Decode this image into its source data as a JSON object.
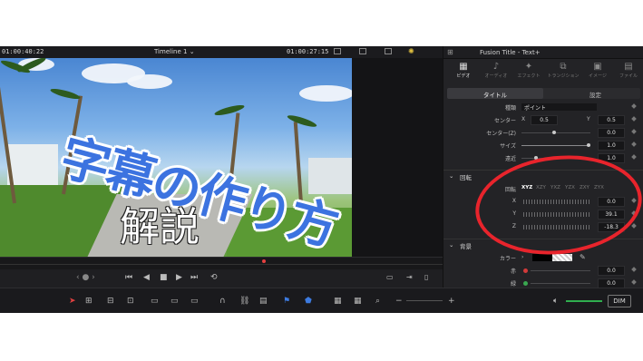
{
  "viewer": {
    "timecode_left": "01:00:40:22",
    "timeline_name": "Timeline 1",
    "timecode_right": "01:00:27:15",
    "overlay_title": "字幕の作り方",
    "overlay_subtitle": "解説"
  },
  "transport": {
    "page_indicator": "‹ ● ›",
    "buttons": [
      "⏮",
      "◀",
      "■",
      "▶",
      "⏭",
      "⟲"
    ]
  },
  "inspector": {
    "title": "Fusion Title - Text+",
    "tabs": [
      {
        "icon": "film-icon",
        "glyph": "▦",
        "label": "ビデオ",
        "active": true
      },
      {
        "icon": "music-icon",
        "glyph": "♪",
        "label": "オーディオ",
        "active": false
      },
      {
        "icon": "effects-icon",
        "glyph": "✦",
        "label": "エフェクト",
        "active": false
      },
      {
        "icon": "transition-icon",
        "glyph": "⧉",
        "label": "トランジション",
        "active": false
      },
      {
        "icon": "image-icon",
        "glyph": "▣",
        "label": "イメージ",
        "active": false
      },
      {
        "icon": "file-icon",
        "glyph": "▤",
        "label": "ファイル",
        "active": false
      }
    ],
    "subtabs": {
      "title": "タイトル",
      "settings": "設定"
    },
    "fields": {
      "kind_label": "種類",
      "kind_value": "ポイント",
      "center_label": "センター",
      "center_x_label": "X",
      "center_x": "0.5",
      "center_y_label": "Y",
      "center_y": "0.5",
      "center_z_label": "センター(Z)",
      "center_z": "0.0",
      "size_label": "サイズ",
      "size": "1.0",
      "perspective_label": "遠近",
      "perspective": "1.0"
    },
    "rotation": {
      "section": "回転",
      "order_label": "回転",
      "orders": [
        "XYZ",
        "XZY",
        "YXZ",
        "YZX",
        "ZXY",
        "ZYX"
      ],
      "x_label": "X",
      "x": "0.0",
      "y_label": "Y",
      "y": "39.1",
      "z_label": "Z",
      "z": "-18.3"
    },
    "background": {
      "section": "背景",
      "color_label": "カラー",
      "red_label": "赤",
      "red": "0.0",
      "green_label": "緑",
      "green": "0.0"
    }
  },
  "toolbar": {
    "dim": "DIM"
  }
}
